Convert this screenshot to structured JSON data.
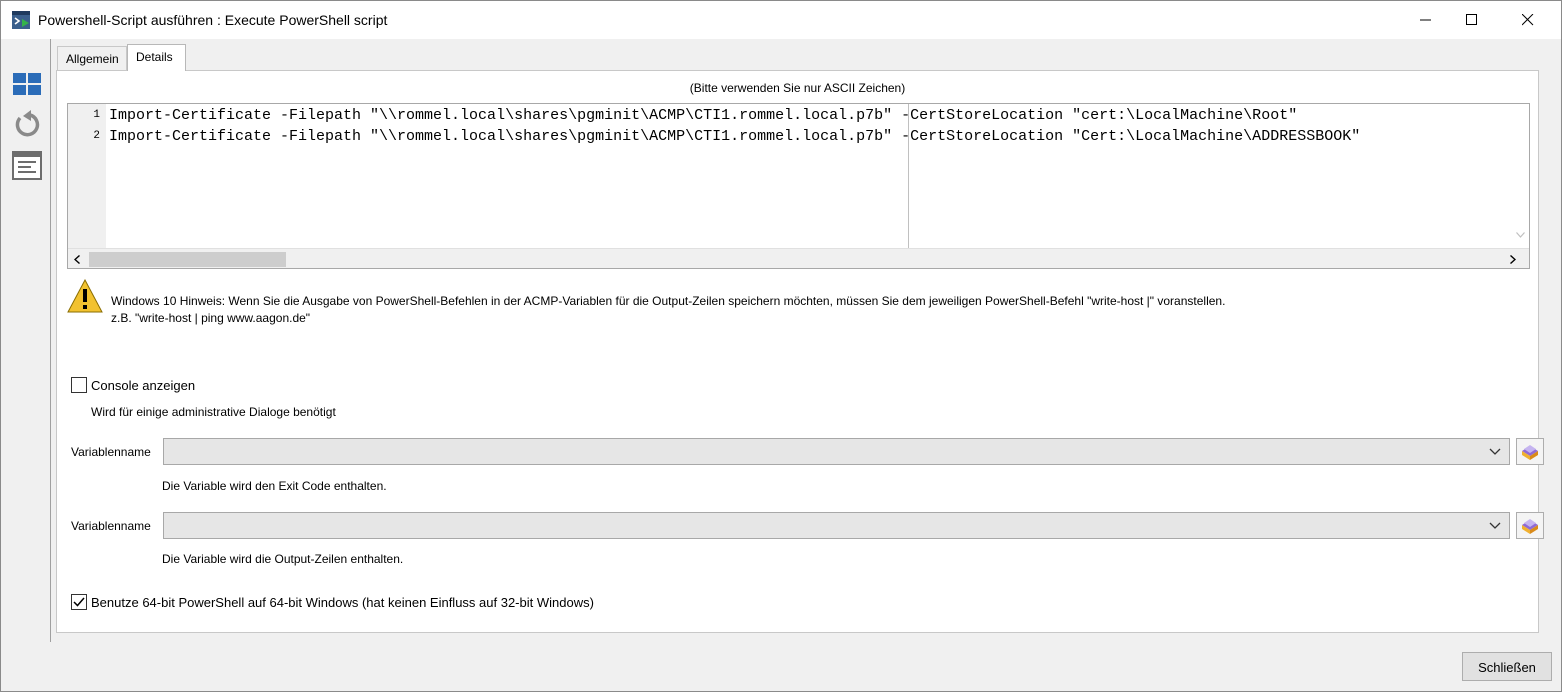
{
  "window": {
    "title": "Powershell-Script ausführen : Execute PowerShell script",
    "icons": [
      "app-icon",
      "minimize-icon",
      "maximize-icon",
      "close-icon"
    ]
  },
  "toolbar": {
    "icons": [
      "layout-grid-icon",
      "undo-icon",
      "form-window-icon"
    ]
  },
  "tabs": [
    {
      "label": "Allgemein",
      "selected": false
    },
    {
      "label": "Details",
      "selected": true
    }
  ],
  "details": {
    "ascii_note": "(Bitte verwenden Sie nur ASCII Zeichen)",
    "code": {
      "lines": [
        {
          "number": "1",
          "text": "Import-Certificate -Filepath \"\\\\rommel.local\\shares\\pgminit\\ACMP\\CTI1.rommel.local.p7b\" -CertStoreLocation \"cert:\\LocalMachine\\Root\""
        },
        {
          "number": "2",
          "text": "Import-Certificate -Filepath \"\\\\rommel.local\\shares\\pgminit\\ACMP\\CTI1.rommel.local.p7b\" -CertStoreLocation \"Cert:\\LocalMachine\\ADDRESSBOOK\""
        }
      ]
    },
    "warning": {
      "icon": "warning-icon",
      "line1": "Windows 10 Hinweis: Wenn Sie die Ausgabe von PowerShell-Befehlen in der ACMP-Variablen für die Output-Zeilen speichern möchten, müssen Sie dem jeweiligen PowerShell-Befehl \"write-host |\" voranstellen.",
      "line2": "z.B. \"write-host | ping www.aagon.de\""
    },
    "console": {
      "label": "Console anzeigen",
      "checked": false,
      "description": "Wird für einige administrative Dialoge benötigt"
    },
    "exit_code_var": {
      "label": "Variablenname",
      "value": "",
      "description": "Die Variable wird den Exit Code enthalten."
    },
    "output_var": {
      "label": "Variablenname",
      "value": "",
      "description": "Die Variable wird die Output-Zeilen enthalten."
    },
    "use64bit": {
      "label": "Benutze 64-bit PowerShell auf 64-bit Windows (hat keinen Einfluss auf 32-bit Windows)",
      "checked": true
    }
  },
  "footer": {
    "close_label": "Schließen"
  },
  "colors": {
    "tile_blue": "#2b6cb8",
    "icon_gray": "#6d6d6d",
    "warning_yellow": "#f2c230"
  }
}
